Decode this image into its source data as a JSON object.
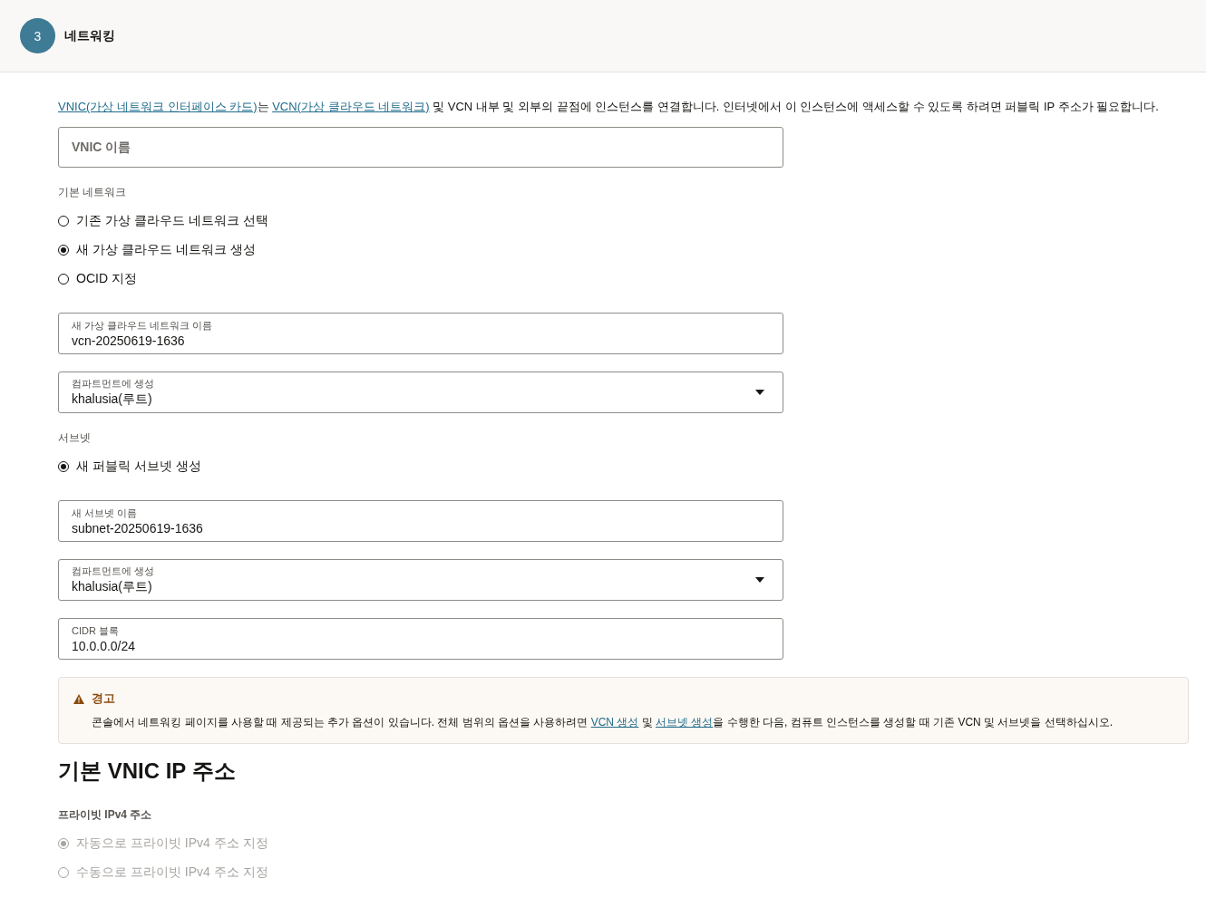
{
  "step": {
    "number": "3",
    "title": "네트워킹"
  },
  "intro": [
    {
      "kind": "link",
      "text": "VNIC(가상 네트워크 인터페이스 카드)"
    },
    {
      "kind": "text",
      "text": "는 "
    },
    {
      "kind": "link",
      "text": "VCN(가상 클라우드 네트워크)"
    },
    {
      "kind": "text",
      "text": " 및 VCN 내부 및 외부의 끝점에 인스턴스를 연결합니다. 인터넷에서 이 인스턴스에 액세스할 수 있도록 하려면 퍼블릭 IP 주소가 필요합니다."
    }
  ],
  "sections": [
    {
      "kind": "field",
      "field": {
        "kind": "text",
        "placeholder": "VNIC 이름"
      }
    },
    {
      "kind": "radios",
      "label": "기본 네트워크",
      "options": [
        {
          "label": "기존 가상 클라우드 네트워크 선택",
          "selected": false,
          "disabled": false
        },
        {
          "label": "새 가상 클라우드 네트워크 생성",
          "selected": true,
          "disabled": false
        },
        {
          "label": "OCID 지정",
          "selected": false,
          "disabled": false
        }
      ]
    },
    {
      "kind": "field",
      "field": {
        "kind": "text",
        "label": "새 가상 클라우드 네트워크 이름",
        "value": "vcn-20250619-1636"
      }
    },
    {
      "kind": "field",
      "field": {
        "kind": "select",
        "label": "컴파트먼트에 생성",
        "value": "khalusia(루트)"
      }
    },
    {
      "kind": "radios",
      "label": "서브넷",
      "options": [
        {
          "label": "새 퍼블릭 서브넷 생성",
          "selected": true,
          "disabled": false
        }
      ]
    },
    {
      "kind": "field",
      "field": {
        "kind": "text",
        "label": "새 서브넷 이름",
        "value": "subnet-20250619-1636"
      }
    },
    {
      "kind": "field",
      "field": {
        "kind": "select",
        "label": "컴파트먼트에 생성",
        "value": "khalusia(루트)"
      }
    },
    {
      "kind": "field",
      "field": {
        "kind": "text",
        "label": "CIDR 블록",
        "value": "10.0.0.0/24"
      }
    }
  ],
  "warning": {
    "title": "경고",
    "message": [
      {
        "kind": "text",
        "text": "콘솔에서 네트워킹 페이지를 사용할 때 제공되는 추가 옵션이 있습니다. 전체 범위의 옵션을 사용하려면 "
      },
      {
        "kind": "link",
        "text": "VCN 생성"
      },
      {
        "kind": "text",
        "text": " 및 "
      },
      {
        "kind": "link",
        "text": "서브넷 생성"
      },
      {
        "kind": "text",
        "text": "을 수행한 다음, 컴퓨트 인스턴스를 생성할 때 기존 VCN 및 서브넷을 선택하십시오."
      }
    ]
  },
  "ip_section": {
    "heading": "기본 VNIC IP 주소",
    "label": "프라이빗 IPv4 주소",
    "options": [
      {
        "label": "자동으로 프라이빗 IPv4 주소 지정",
        "selected": true,
        "disabled": true
      },
      {
        "label": "수동으로 프라이빗 IPv4 주소 지정",
        "selected": false,
        "disabled": true
      }
    ]
  }
}
